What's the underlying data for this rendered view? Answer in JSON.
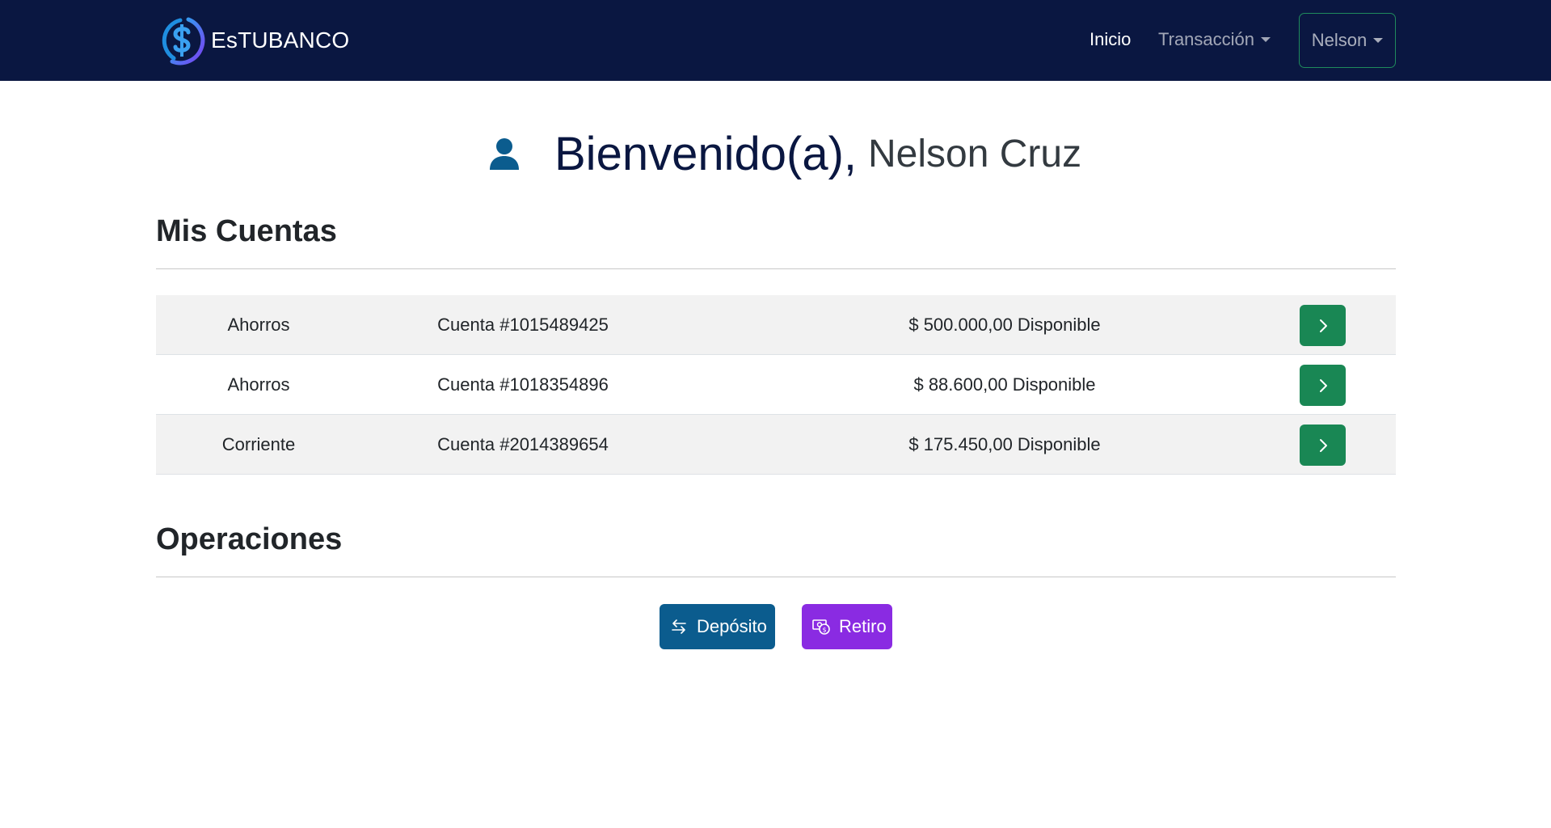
{
  "navbar": {
    "brand": "EsTUBANCO",
    "links": {
      "inicio": "Inicio",
      "transaccion": "Transacción"
    },
    "user_menu": "Nelson"
  },
  "welcome": {
    "greeting": "Bienvenido(a),",
    "name": "Nelson Cruz"
  },
  "accounts_section": {
    "title": "Mis Cuentas",
    "rows": [
      {
        "type": "Ahorros",
        "number": "Cuenta #1015489425",
        "balance": "$ 500.000,00 Disponible"
      },
      {
        "type": "Ahorros",
        "number": "Cuenta #1018354896",
        "balance": "$ 88.600,00 Disponible"
      },
      {
        "type": "Corriente",
        "number": "Cuenta #2014389654",
        "balance": "$ 175.450,00 Disponible"
      }
    ]
  },
  "operations_section": {
    "title": "Operaciones",
    "deposit_label": "Depósito",
    "withdraw_label": "Retiro"
  },
  "colors": {
    "navbar_bg": "#0a1741",
    "success": "#198754",
    "deposit": "#0b5c8e",
    "withdraw": "#8a2be2",
    "user_icon": "#0b5c8e"
  },
  "icons": {
    "logo": "dollar-circle-logo",
    "user": "person-icon",
    "row_action": "chevron-right-icon",
    "deposit": "arrows-exchange-icon",
    "withdraw": "cash-coin-icon"
  }
}
